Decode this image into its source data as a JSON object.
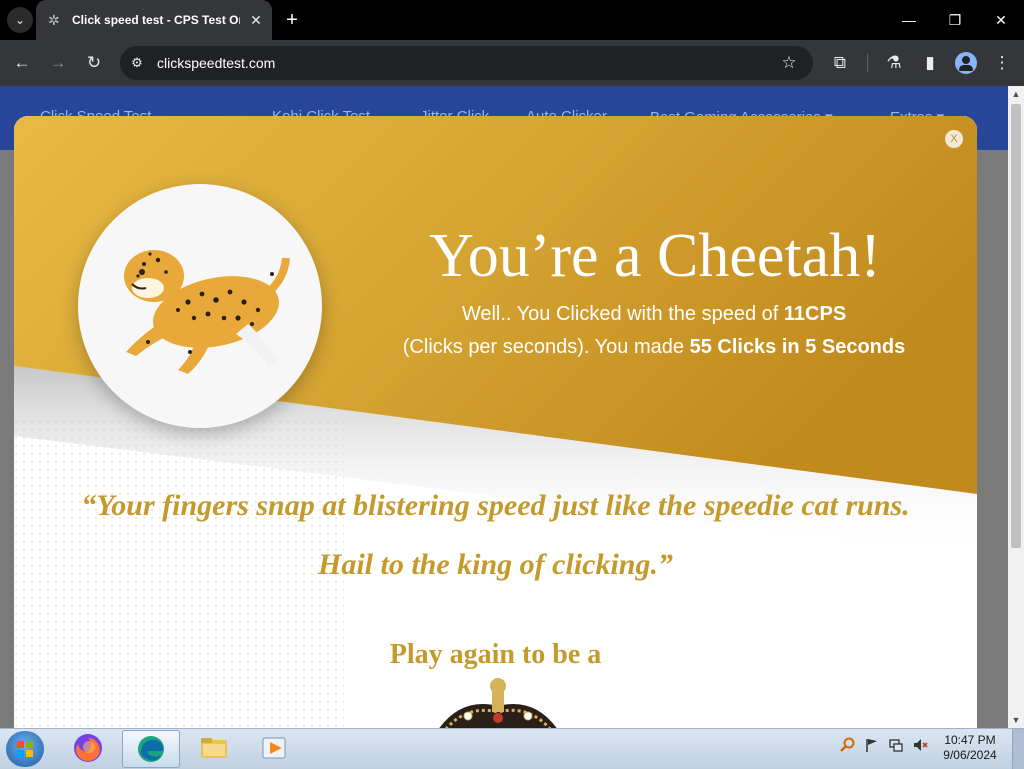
{
  "browser": {
    "tab_title": "Click speed test - CPS Test Onli",
    "url": "clickspeedtest.com",
    "tab_menu_icon": "chevron-down-icon",
    "new_tab_icon": "plus-icon"
  },
  "site_nav": {
    "items": [
      "Click Speed Test",
      "Kohi Click Test",
      "Jitter Click",
      "Auto Clicker",
      "Best Gaming Accessories ▾",
      "Extras ▾"
    ]
  },
  "modal": {
    "close_label": "X",
    "title": "You’re a Cheetah!",
    "line1_prefix": "Well.. You Clicked with the speed of ",
    "line1_value": "11CPS",
    "line2_prefix": "(Clicks per seconds). You made ",
    "line2_value": "55 Clicks in 5 Seconds",
    "quote_line1": "“Your fingers snap at blistering speed just like the speedie cat runs.",
    "quote_line2": "Hail to the king of clicking.”",
    "play_again": "Play again to be a",
    "colors": {
      "gold": "#c49a2c",
      "banner_gold": "#d9a93a"
    }
  },
  "taskbar": {
    "time": "10:47 PM",
    "date": "9/06/2024",
    "apps": [
      "firefox-icon",
      "edge-icon",
      "file-explorer-icon",
      "media-player-icon"
    ]
  }
}
